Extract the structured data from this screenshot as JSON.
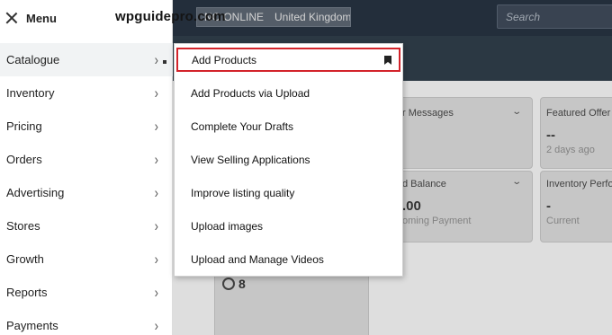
{
  "watermark": "wpguidepro.com",
  "topbar": {
    "store_name": "NO ONLINE",
    "marketplace": "United Kingdom",
    "search_placeholder": "Search"
  },
  "dashboard": {
    "messages_title": "r Messages",
    "featured_offer": {
      "title": "Featured Offer %",
      "value": "--",
      "sub": "2 days ago"
    },
    "balance": {
      "title": "d Balance",
      "value": ".00",
      "sub": "oming Payment"
    },
    "inventory": {
      "title": "Inventory Perfo",
      "value": "-",
      "sub": "Current"
    },
    "globe_count": "8"
  },
  "menu": {
    "title": "Menu",
    "items": [
      {
        "label": "Catalogue"
      },
      {
        "label": "Inventory"
      },
      {
        "label": "Pricing"
      },
      {
        "label": "Orders"
      },
      {
        "label": "Advertising"
      },
      {
        "label": "Stores"
      },
      {
        "label": "Growth"
      },
      {
        "label": "Reports"
      },
      {
        "label": "Payments"
      }
    ]
  },
  "submenu": {
    "items": [
      {
        "label": "Add Products"
      },
      {
        "label": "Add Products via Upload"
      },
      {
        "label": "Complete Your Drafts"
      },
      {
        "label": "View Selling Applications"
      },
      {
        "label": "Improve listing quality"
      },
      {
        "label": "Upload images"
      },
      {
        "label": "Upload and Manage Videos"
      }
    ]
  },
  "colors": {
    "header": "#232f3e",
    "highlight_border": "#d3232a"
  }
}
